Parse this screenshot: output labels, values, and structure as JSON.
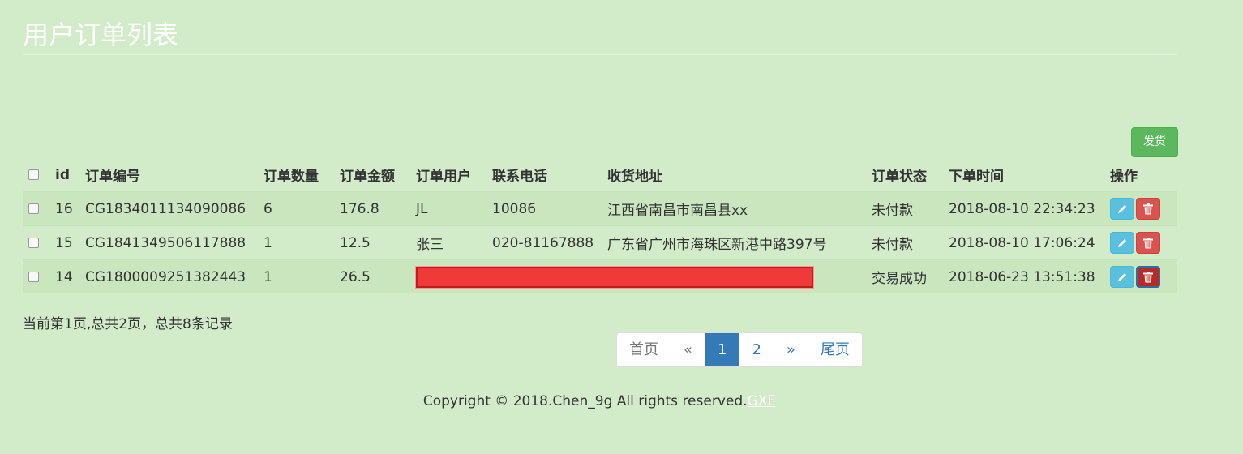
{
  "page": {
    "title": "用户订单列表"
  },
  "toolbar": {
    "ship_label": "发货"
  },
  "table": {
    "headers": [
      "id",
      "订单编号",
      "订单数量",
      "订单金额",
      "订单用户",
      "联系电话",
      "收货地址",
      "订单状态",
      "下单时间",
      "操作"
    ],
    "rows": [
      {
        "id": "16",
        "order_no": "CG1834011134090086",
        "qty": "6",
        "amount": "176.8",
        "user": "JL",
        "phone": "10086",
        "address": "江西省南昌市南昌县xx",
        "status": "未付款",
        "time": "2018-08-10 22:34:23"
      },
      {
        "id": "15",
        "order_no": "CG1841349506117888",
        "qty": "1",
        "amount": "12.5",
        "user": "张三",
        "phone": "020-81167888",
        "address": "广东省广州市海珠区新港中路397号",
        "status": "未付款",
        "time": "2018-08-10 17:06:24"
      },
      {
        "id": "14",
        "order_no": "CG1800009251382443",
        "qty": "1",
        "amount": "26.5",
        "user": "",
        "phone": "",
        "address": "",
        "status": "交易成功",
        "time": "2018-06-23 13:51:38"
      }
    ]
  },
  "summary": "当前第1页,总共2页，总共8条记录",
  "pagination": {
    "first": "首页",
    "prev": "«",
    "page1": "1",
    "page2": "2",
    "next": "»",
    "last": "尾页"
  },
  "footer": {
    "copyright": "Copyright © 2018.Chen_9g All rights reserved.",
    "link": "GXF"
  },
  "colors": {
    "background": "#d2ebc9",
    "primary": "#337ab7",
    "success": "#5cb85c",
    "info": "#5bc0de",
    "danger": "#d9534f"
  },
  "icons": {
    "edit": "pencil-icon",
    "delete": "trash-icon"
  }
}
